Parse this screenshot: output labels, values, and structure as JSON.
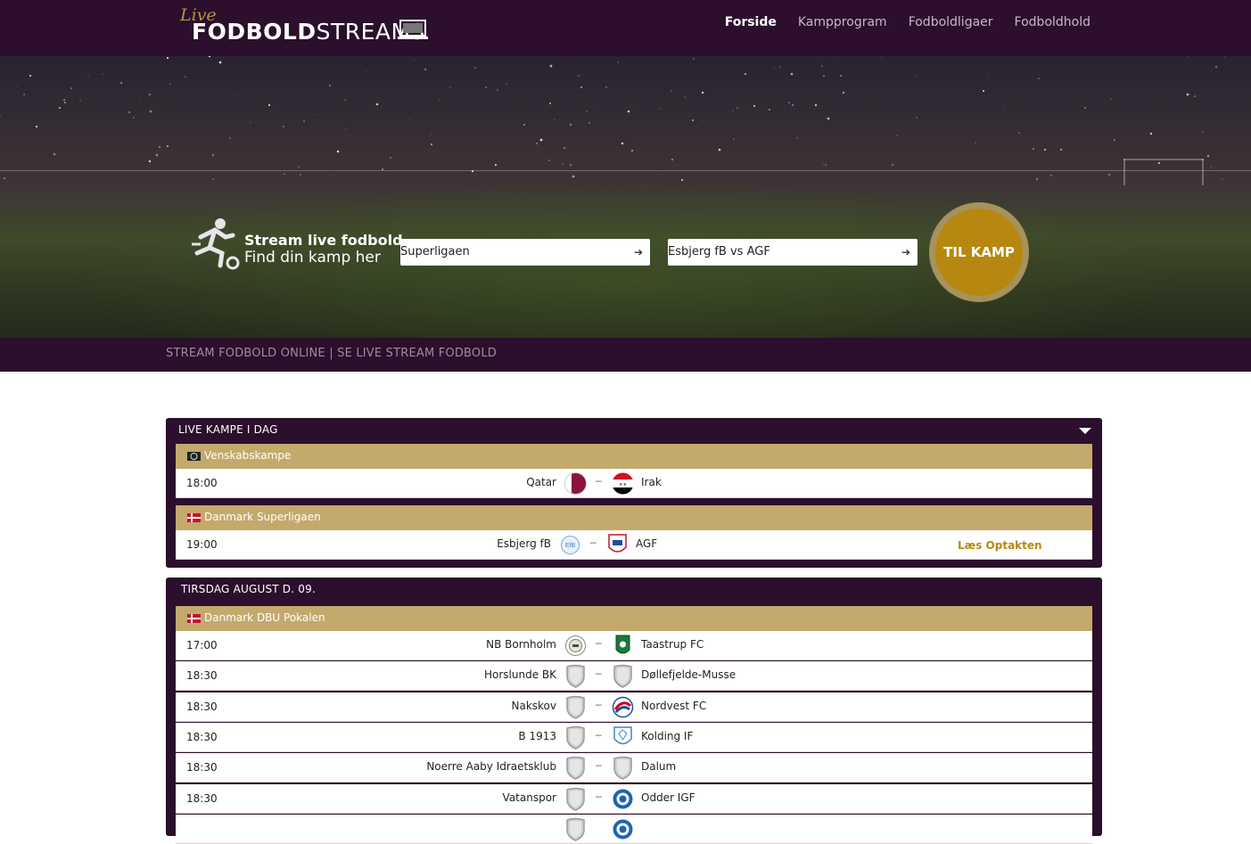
{
  "header": {
    "logo_live": "Live",
    "logo_bold": "FODBOLD",
    "logo_light": "STREAMS",
    "nav": [
      "Forside",
      "Kampprogram",
      "Fodboldligaer",
      "Fodboldhold"
    ]
  },
  "hero": {
    "title": "Stream live fodbold",
    "subtitle": "Find din kamp her",
    "select_league": "Superligaen",
    "select_match": "Esbjerg fB vs AGF",
    "button": "TIL KAMP"
  },
  "subbar": {
    "text": "STREAM FODBOLD ONLINE | SE LIVE STREAM FODBOLD"
  },
  "today": {
    "title": "LIVE KAMPE I DAG",
    "leagues": [
      {
        "name": "Venskabskampe",
        "flag": "world",
        "matches": [
          {
            "time": "18:00",
            "home": "Qatar",
            "away": "Irak",
            "home_crest": "flag-qatar",
            "away_crest": "flag-iraq"
          }
        ]
      },
      {
        "name": "Danmark Superligaen",
        "flag": "denmark",
        "matches": [
          {
            "time": "19:00",
            "home": "Esbjerg fB",
            "away": "AGF",
            "home_crest": "crest-esbjerg",
            "away_crest": "crest-agf",
            "preview": "Læs Optakten"
          }
        ]
      }
    ]
  },
  "tuesday": {
    "title": "TIRSDAG AUGUST D. 09.",
    "league": "Danmark DBU Pokalen",
    "matches": [
      {
        "time": "17:00",
        "home": "NB Bornholm",
        "away": "Taastrup FC",
        "home_crest": "crest-nb-bornholm",
        "away_crest": "crest-taastrup"
      },
      {
        "time": "18:30",
        "home": "Horslunde BK",
        "away": "Døllefjelde-Musse",
        "home_crest": "shield-generic",
        "away_crest": "shield-generic"
      },
      {
        "time": "18:30",
        "home": "Nakskov",
        "away": "Nordvest FC",
        "home_crest": "shield-generic",
        "away_crest": "crest-nordvest"
      },
      {
        "time": "18:30",
        "home": "B 1913",
        "away": "Kolding IF",
        "home_crest": "shield-generic",
        "away_crest": "crest-kolding"
      },
      {
        "time": "18:30",
        "home": "Noerre Aaby Idraetsklub",
        "away": "Dalum",
        "home_crest": "shield-generic",
        "away_crest": "shield-generic"
      },
      {
        "time": "18:30",
        "home": "Vatanspor",
        "away": "Odder IGF",
        "home_crest": "shield-generic",
        "away_crest": "crest-odder"
      }
    ]
  },
  "colors": {
    "header_bg": "#2b0f2c",
    "league_bar": "#c4a96c",
    "accent": "#b7880f"
  }
}
